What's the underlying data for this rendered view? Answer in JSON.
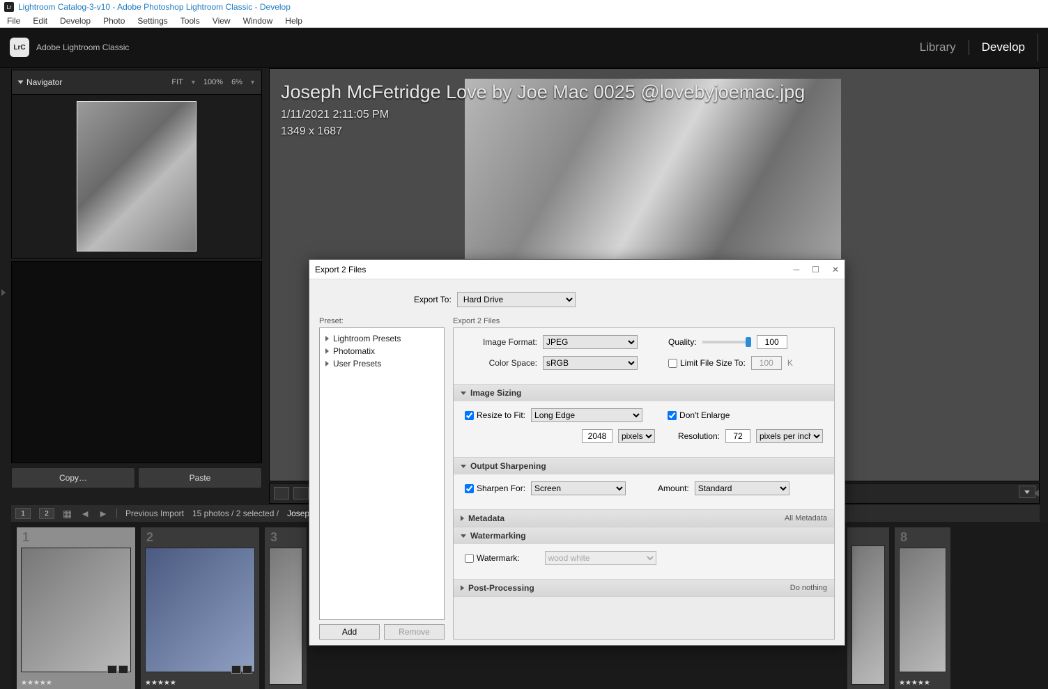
{
  "window": {
    "title": "Lightroom Catalog-3-v10 - Adobe Photoshop Lightroom Classic - Develop"
  },
  "menubar": [
    "File",
    "Edit",
    "Develop",
    "Photo",
    "Settings",
    "Tools",
    "View",
    "Window",
    "Help"
  ],
  "brand": "Adobe Lightroom Classic",
  "modules": {
    "library": "Library",
    "develop": "Develop"
  },
  "navigator": {
    "title": "Navigator",
    "fit": "FIT",
    "zoom100": "100%",
    "zoom6": "6%"
  },
  "copy_btn": "Copy…",
  "paste_btn": "Paste",
  "photo_meta": {
    "filename": "Joseph McFetridge Love by Joe Mac 0025 @lovebyjoemac.jpg",
    "datetime": "1/11/2021 2:11:05 PM",
    "dimensions": "1349 x 1687"
  },
  "filmstrip_header": {
    "page1": "1",
    "page2": "2",
    "label": "Previous Import",
    "count": "15 photos / 2 selected /",
    "name": "Joseph McFe"
  },
  "thumbs": [
    {
      "num": "1",
      "stars": "★★★★★"
    },
    {
      "num": "2",
      "stars": "★★★★★"
    },
    {
      "num": "3",
      "stars": ""
    },
    {
      "num": "8",
      "stars": "★★★★★"
    }
  ],
  "dialog": {
    "title": "Export 2 Files",
    "export_to_label": "Export To:",
    "export_to_value": "Hard Drive",
    "preset_label": "Preset:",
    "right_label": "Export 2 Files",
    "presets": [
      "Lightroom Presets",
      "Photomatix",
      "User Presets"
    ],
    "add": "Add",
    "remove": "Remove",
    "sections": {
      "file_settings": {
        "image_format_label": "Image Format:",
        "image_format": "JPEG",
        "quality_label": "Quality:",
        "quality": "100",
        "color_space_label": "Color Space:",
        "color_space": "sRGB",
        "limit_label": "Limit File Size To:",
        "limit_value": "100",
        "limit_unit": "K"
      },
      "image_sizing": {
        "title": "Image Sizing",
        "resize_label": "Resize to Fit:",
        "resize_method": "Long Edge",
        "dont_enlarge": "Don't Enlarge",
        "size_value": "2048",
        "size_unit": "pixels",
        "res_label": "Resolution:",
        "res_value": "72",
        "res_unit": "pixels per inch"
      },
      "output_sharpening": {
        "title": "Output Sharpening",
        "sharpen_label": "Sharpen For:",
        "sharpen_for": "Screen",
        "amount_label": "Amount:",
        "amount": "Standard"
      },
      "metadata": {
        "title": "Metadata",
        "summary": "All Metadata"
      },
      "watermarking": {
        "title": "Watermarking",
        "label": "Watermark:",
        "value": "wood white"
      },
      "post_processing": {
        "title": "Post-Processing",
        "summary": "Do nothing"
      }
    }
  }
}
